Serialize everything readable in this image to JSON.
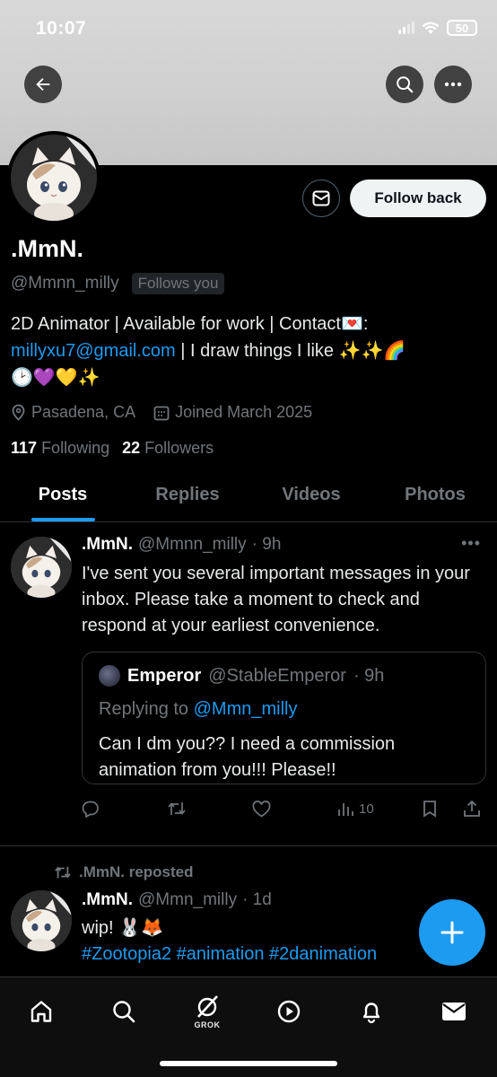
{
  "status_bar": {
    "time": "10:07",
    "battery": "50"
  },
  "profile": {
    "name": ".MmN.",
    "handle": "@Mmnn_milly",
    "follows_you": "Follows you",
    "follow_back_label": "Follow back",
    "bio_line1": "2D Animator | Available for work | Contact💌:",
    "bio_email": "millyxu7@gmail.com",
    "bio_line2_rest": " | I draw things I like ✨✨🌈",
    "bio_line3": "🕑💜💛✨",
    "location": "Pasadena, CA",
    "joined": "Joined March 2025",
    "following_count": "117",
    "following_label": "Following",
    "followers_count": "22",
    "followers_label": "Followers"
  },
  "tabs": [
    "Posts",
    "Replies",
    "Videos",
    "Photos"
  ],
  "posts": [
    {
      "name": ".MmN.",
      "handle": "@Mmnn_milly",
      "time": "· 9h",
      "text": "I've sent you several important messages in your inbox. Please take a moment to check and respond at your earliest convenience.",
      "quote": {
        "name": "Emperor",
        "handle": "@StableEmperor",
        "time": "· 9h",
        "replying_prefix": "Replying to ",
        "replying_to": "@Mmn_milly",
        "text": "Can I dm you?? I need a commission animation from you!!! Please!!"
      },
      "views": "10"
    },
    {
      "repost_label": ".MmN. reposted",
      "name": ".MmN.",
      "handle": "@Mmn_milly",
      "time": "· 1d",
      "text": "wip! 🐰🦊",
      "hashtags": "#Zootopia2 #animation #2danimation"
    }
  ],
  "nav": {
    "grok_label": "GROK"
  },
  "colors": {
    "accent": "#1d9bf0",
    "background": "#000000",
    "muted": "#71767b"
  }
}
